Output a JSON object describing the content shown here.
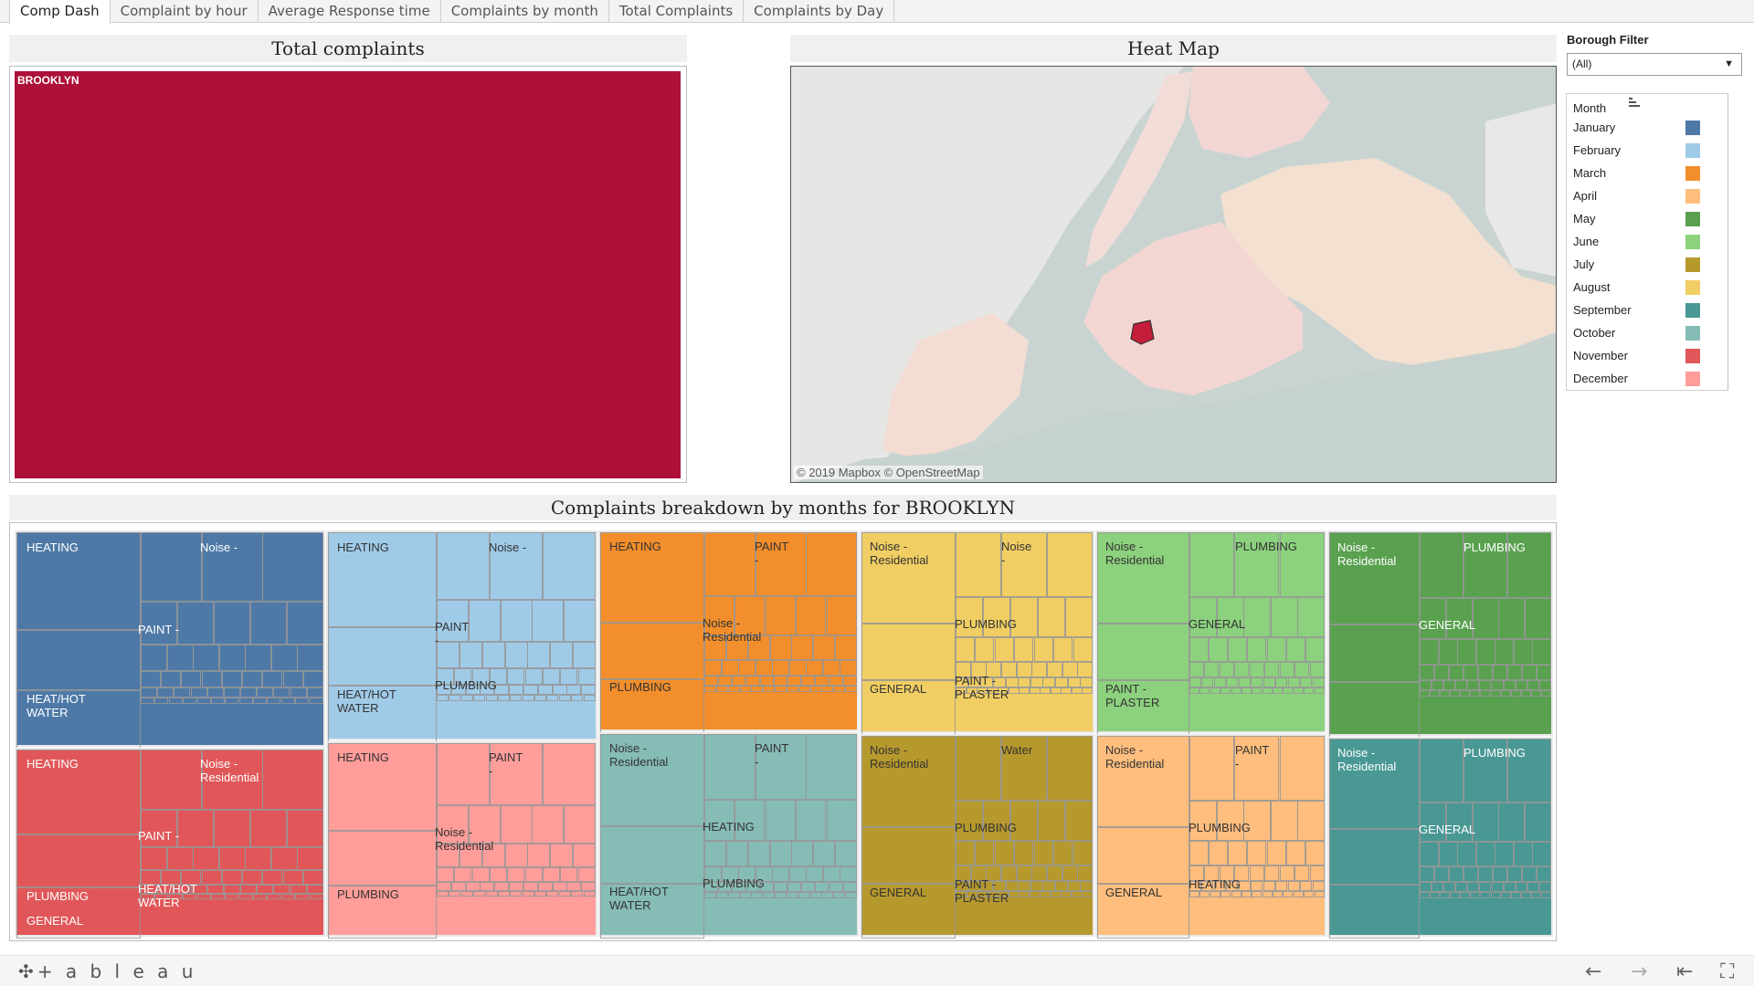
{
  "tabs": [
    {
      "label": "Comp Dash",
      "active": true
    },
    {
      "label": "Complaint by hour"
    },
    {
      "label": "Average Response time"
    },
    {
      "label": "Complaints by month"
    },
    {
      "label": "Total Complaints"
    },
    {
      "label": "Complaints by Day"
    }
  ],
  "total_complaints": {
    "title": "Total complaints",
    "borough": "BROOKLYN",
    "color": "#ad1038"
  },
  "heat_map": {
    "title": "Heat Map",
    "attribution": "© 2019 Mapbox © OpenStreetMap"
  },
  "borough_filter": {
    "title": "Borough Filter",
    "value": "(All)"
  },
  "legend": {
    "title": "Month",
    "items": [
      {
        "label": "January",
        "color": "#4e79a7"
      },
      {
        "label": "February",
        "color": "#a0cbe8"
      },
      {
        "label": "March",
        "color": "#f28e2b"
      },
      {
        "label": "April",
        "color": "#ffbe7d"
      },
      {
        "label": "May",
        "color": "#59a14f"
      },
      {
        "label": "June",
        "color": "#8cd17d"
      },
      {
        "label": "July",
        "color": "#b6992d"
      },
      {
        "label": "August",
        "color": "#f1ce63"
      },
      {
        "label": "September",
        "color": "#499894"
      },
      {
        "label": "October",
        "color": "#86bcb6"
      },
      {
        "label": "November",
        "color": "#e15759"
      },
      {
        "label": "December",
        "color": "#ff9d9a"
      }
    ]
  },
  "breakdown": {
    "title": "Complaints breakdown by months for BROOKLYN",
    "months": [
      {
        "month": "January",
        "color": "#4e79a7",
        "text_color": "#ffffff",
        "labels": [
          "HEATING",
          "Noise -",
          "PAINT -",
          "HEAT/HOT\nWATER"
        ]
      },
      {
        "month": "November",
        "color": "#e15759",
        "text_color": "#ffffff",
        "labels": [
          "HEATING",
          "Noise -\nResidential",
          "PAINT -",
          "PLUMBING",
          "HEAT/HOT\nWATER",
          "GENERAL"
        ]
      },
      {
        "month": "February",
        "color": "#a0cbe8",
        "text_color": "#333333",
        "labels": [
          "HEATING",
          "Noise -",
          "PAINT\n-",
          "HEAT/HOT\nWATER",
          "PLUMBING"
        ]
      },
      {
        "month": "December",
        "color": "#ff9d9a",
        "text_color": "#333333",
        "labels": [
          "HEATING",
          "PAINT\n-",
          "Noise -\nResidential",
          "PLUMBING"
        ]
      },
      {
        "month": "March",
        "color": "#f28e2b",
        "text_color": "#333333",
        "labels": [
          "HEATING",
          "PAINT\n-",
          "Noise -\nResidential",
          "PLUMBING"
        ]
      },
      {
        "month": "October",
        "color": "#86bcb6",
        "text_color": "#333333",
        "labels": [
          "Noise -\nResidential",
          "PAINT\n-",
          "HEATING",
          "HEAT/HOT\nWATER",
          "PLUMBING"
        ]
      },
      {
        "month": "August",
        "color": "#f1ce63",
        "text_color": "#333333",
        "labels": [
          "Noise -\nResidential",
          "Noise\n-",
          "PLUMBING",
          "GENERAL",
          "PAINT -\nPLASTER"
        ]
      },
      {
        "month": "July",
        "color": "#b6992d",
        "text_color": "#333333",
        "labels": [
          "Noise -\nResidential",
          "Water",
          "PLUMBING",
          "GENERAL",
          "PAINT -\nPLASTER"
        ]
      },
      {
        "month": "June",
        "color": "#8cd17d",
        "text_color": "#333333",
        "labels": [
          "Noise -\nResidential",
          "PLUMBING",
          "GENERAL",
          "PAINT -\nPLASTER"
        ]
      },
      {
        "month": "April",
        "color": "#ffbe7d",
        "text_color": "#333333",
        "labels": [
          "Noise -\nResidential",
          "PAINT\n-",
          "PLUMBING",
          "GENERAL",
          "HEATING"
        ]
      },
      {
        "month": "May",
        "color": "#59a14f",
        "text_color": "#ffffff",
        "labels": [
          "Noise -\nResidential",
          "PLUMBING",
          "GENERAL"
        ]
      },
      {
        "month": "September",
        "color": "#499894",
        "text_color": "#ffffff",
        "labels": [
          "Noise -\nResidential",
          "PLUMBING",
          "GENERAL"
        ]
      }
    ]
  },
  "footer": {
    "logo": "+ a b l e a u"
  }
}
